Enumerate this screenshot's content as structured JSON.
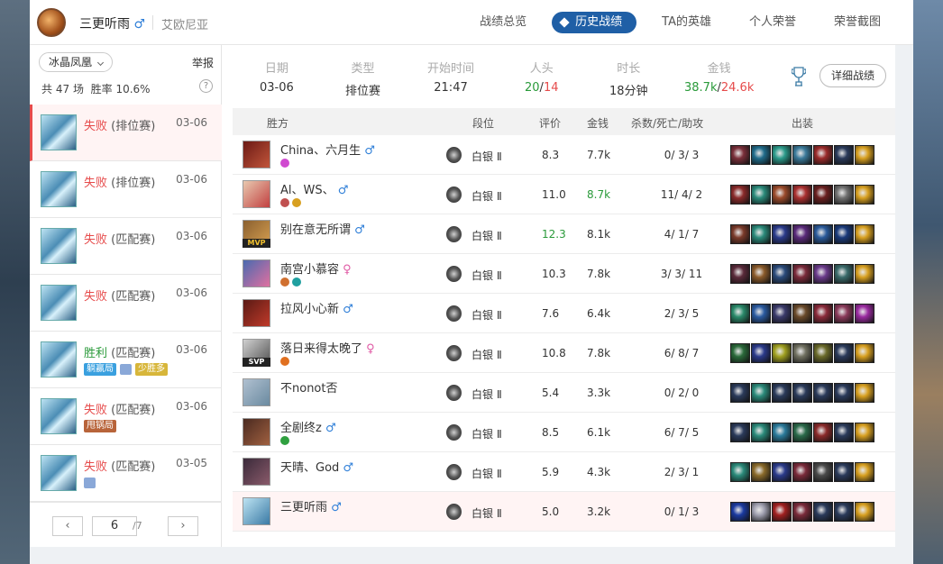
{
  "header": {
    "username": "三更听雨",
    "gender": "♂",
    "server": "艾欧尼亚",
    "tabs": [
      {
        "label": "战绩总览",
        "active": false
      },
      {
        "label": "历史战绩",
        "active": true
      },
      {
        "label": "TA的英雄",
        "active": false
      },
      {
        "label": "个人荣誉",
        "active": false
      },
      {
        "label": "荣誉截图",
        "active": false
      }
    ]
  },
  "sidebar": {
    "season": "冰晶凤凰",
    "report": "举报",
    "stats_prefix": "共",
    "games": "47",
    "games_unit": "场",
    "winrate_label": "胜率",
    "winrate": "10.6%",
    "help": "?",
    "matches": [
      {
        "result": "失败",
        "type": "(排位赛)",
        "date": "03-06",
        "win": false,
        "selected": true,
        "badges": []
      },
      {
        "result": "失败",
        "type": "(排位赛)",
        "date": "03-06",
        "win": false,
        "selected": false,
        "badges": []
      },
      {
        "result": "失败",
        "type": "(匹配赛)",
        "date": "03-06",
        "win": false,
        "selected": false,
        "badges": []
      },
      {
        "result": "失败",
        "type": "(匹配赛)",
        "date": "03-06",
        "win": false,
        "selected": false,
        "badges": []
      },
      {
        "result": "胜利",
        "type": "(匹配赛)",
        "date": "03-06",
        "win": true,
        "selected": false,
        "badges": [
          {
            "text": "躺赢局",
            "style": "blue"
          },
          {
            "text": "",
            "style": "pic"
          },
          {
            "text": "少胜多",
            "style": "yellow"
          }
        ]
      },
      {
        "result": "失败",
        "type": "(匹配赛)",
        "date": "03-06",
        "win": false,
        "selected": false,
        "badges": [
          {
            "text": "甩锅局",
            "style": "brown"
          }
        ]
      },
      {
        "result": "失败",
        "type": "(匹配赛)",
        "date": "03-05",
        "win": false,
        "selected": false,
        "badges": [
          {
            "text": "",
            "style": "pic"
          }
        ]
      }
    ],
    "pager": {
      "prev": "‹",
      "next": "›",
      "current": "6",
      "total": "/7"
    }
  },
  "summary": {
    "date_label": "日期",
    "date": "03-06",
    "type_label": "类型",
    "type": "排位赛",
    "start_label": "开始时间",
    "start": "21:47",
    "kills_label": "人头",
    "kills_a": "20",
    "kills_sep": "/",
    "kills_b": "14",
    "duration_label": "时长",
    "duration": "18分钟",
    "gold_label": "金钱",
    "gold_a": "38.7k",
    "gold_sep": "/",
    "gold_b": "24.6k",
    "detail_button": "详细战绩"
  },
  "table": {
    "headers": {
      "team": "胜方",
      "rank": "段位",
      "score": "评价",
      "gold": "金钱",
      "kda": "杀数/死亡/助攻",
      "items": "出装"
    },
    "rows": [
      {
        "name": "China、六月生",
        "gender": "♂",
        "rank": "白银 Ⅱ",
        "score": "8.3",
        "gold": "7.7k",
        "kda": "0/ 3/ 3",
        "hl_score": false,
        "hl_gold": false,
        "badge": "",
        "tags": [
          "#d04ad0"
        ],
        "avatar": [
          "#6b1a14",
          "#c2553b"
        ],
        "items": [
          "#7a2f3a",
          "#1f6b8a",
          "#2b9a8a",
          "#3a7a9a",
          "#9a2a2a",
          "#2a3a5a",
          "#d8a020"
        ],
        "me": false
      },
      {
        "name": "Al、WS、",
        "gender": "♂",
        "rank": "白银 Ⅱ",
        "score": "11.0",
        "gold": "8.7k",
        "kda": "11/ 4/ 2",
        "hl_score": false,
        "hl_gold": true,
        "badge": "",
        "tags": [
          "#c05050",
          "#d8a020"
        ],
        "avatar": [
          "#e8c9b0",
          "#c24040"
        ],
        "items": [
          "#8a2a2a",
          "#2a8a7a",
          "#9a4a2a",
          "#aa3030",
          "#6a2020",
          "#707070",
          "#d8a020"
        ],
        "me": false
      },
      {
        "name": "别在意无所谓",
        "gender": "♂",
        "rank": "白银 Ⅱ",
        "score": "12.3",
        "gold": "8.1k",
        "kda": "4/ 1/ 7",
        "hl_score": true,
        "hl_gold": false,
        "badge": "MVP",
        "tags": [],
        "avatar": [
          "#8a6030",
          "#d8a050"
        ],
        "items": [
          "#7a3a2a",
          "#2a8a7a",
          "#2a3a8a",
          "#5a2a7a",
          "#2a5a9a",
          "#1a3a7a",
          "#d8a020"
        ],
        "me": false
      },
      {
        "name": "南宫小慕容",
        "gender": "♀",
        "rank": "白银 Ⅱ",
        "score": "10.3",
        "gold": "7.8k",
        "kda": "3/ 3/ 11",
        "hl_score": false,
        "hl_gold": false,
        "badge": "",
        "tags": [
          "#d07030",
          "#20a0a0"
        ],
        "avatar": [
          "#4a6ab0",
          "#e070a0"
        ],
        "items": [
          "#5a2a3a",
          "#8a5a2a",
          "#2a4a7a",
          "#7a2a3a",
          "#6a3a8a",
          "#3a6a6a",
          "#d8a020"
        ],
        "me": false
      },
      {
        "name": "拉风小心新",
        "gender": "♂",
        "rank": "白银 Ⅱ",
        "score": "7.6",
        "gold": "6.4k",
        "kda": "2/ 3/ 5",
        "hl_score": false,
        "hl_gold": false,
        "badge": "",
        "tags": [],
        "avatar": [
          "#5a1a14",
          "#c03a2a"
        ],
        "items": [
          "#2a8a6a",
          "#2a5aa0",
          "#3a3a6a",
          "#6a4a2a",
          "#8a2a3a",
          "#8a3a5a",
          "#9a2aa0"
        ],
        "me": false
      },
      {
        "name": "落日来得太晚了",
        "gender": "♀",
        "rank": "白银 Ⅱ",
        "score": "10.8",
        "gold": "7.8k",
        "kda": "6/ 8/ 7",
        "hl_score": false,
        "hl_gold": false,
        "badge": "SVP",
        "tags": [
          "#e07020"
        ],
        "avatar": [
          "#d0d0d0",
          "#505050"
        ],
        "items": [
          "#2a6a3a",
          "#2a3a8a",
          "#a0a020",
          "#707060",
          "#6a6a2a",
          "#2a3a5a",
          "#d8a020"
        ],
        "me": false
      },
      {
        "name": "不nonot否",
        "gender": "",
        "rank": "白银 Ⅱ",
        "score": "5.4",
        "gold": "3.3k",
        "kda": "0/ 2/ 0",
        "hl_score": false,
        "hl_gold": false,
        "badge": "",
        "tags": [],
        "avatar": [
          "#b0c0d0",
          "#6a8aa0"
        ],
        "items": [
          "#2a3a5a",
          "#2a8a7a",
          "#2a3a5a",
          "#2a3a5a",
          "#2a3a5a",
          "#2a3a5a",
          "#d8a020"
        ],
        "me": false
      },
      {
        "name": "全剧终z",
        "gender": "♂",
        "rank": "白银 Ⅱ",
        "score": "8.5",
        "gold": "6.1k",
        "kda": "6/ 7/ 5",
        "hl_score": false,
        "hl_gold": false,
        "badge": "",
        "tags": [
          "#30a040"
        ],
        "avatar": [
          "#4a2a20",
          "#a06040"
        ],
        "items": [
          "#2a3a5a",
          "#2a8a7a",
          "#2a7a9a",
          "#2a6a4a",
          "#8a2a2a",
          "#2a3a5a",
          "#d8a020"
        ],
        "me": false
      },
      {
        "name": "天晴、God",
        "gender": "♂",
        "rank": "白银 Ⅱ",
        "score": "5.9",
        "gold": "4.3k",
        "kda": "2/ 3/ 1",
        "hl_score": false,
        "hl_gold": false,
        "badge": "",
        "tags": [],
        "avatar": [
          "#3a2a3a",
          "#8a5a6a"
        ],
        "items": [
          "#2a8a7a",
          "#8a6a2a",
          "#2a3a8a",
          "#7a2a3a",
          "#4a4a4a",
          "#2a3a5a",
          "#d8a020"
        ],
        "me": false
      },
      {
        "name": "三更听雨",
        "gender": "♂",
        "rank": "白银 Ⅱ",
        "score": "5.0",
        "gold": "3.2k",
        "kda": "0/ 1/ 3",
        "hl_score": false,
        "hl_gold": false,
        "badge": "",
        "tags": [],
        "avatar": [
          "#bde3f2",
          "#3a7aa5"
        ],
        "items": [
          "#1a3aa0",
          "#a0a0b0",
          "#a02020",
          "#7a2a3a",
          "#2a3a5a",
          "#2a3a5a",
          "#d8a020"
        ],
        "me": true
      }
    ]
  },
  "colors": {
    "accent": "#1f5fa6",
    "loss": "#e64b4b",
    "win": "#2a9a3a"
  }
}
